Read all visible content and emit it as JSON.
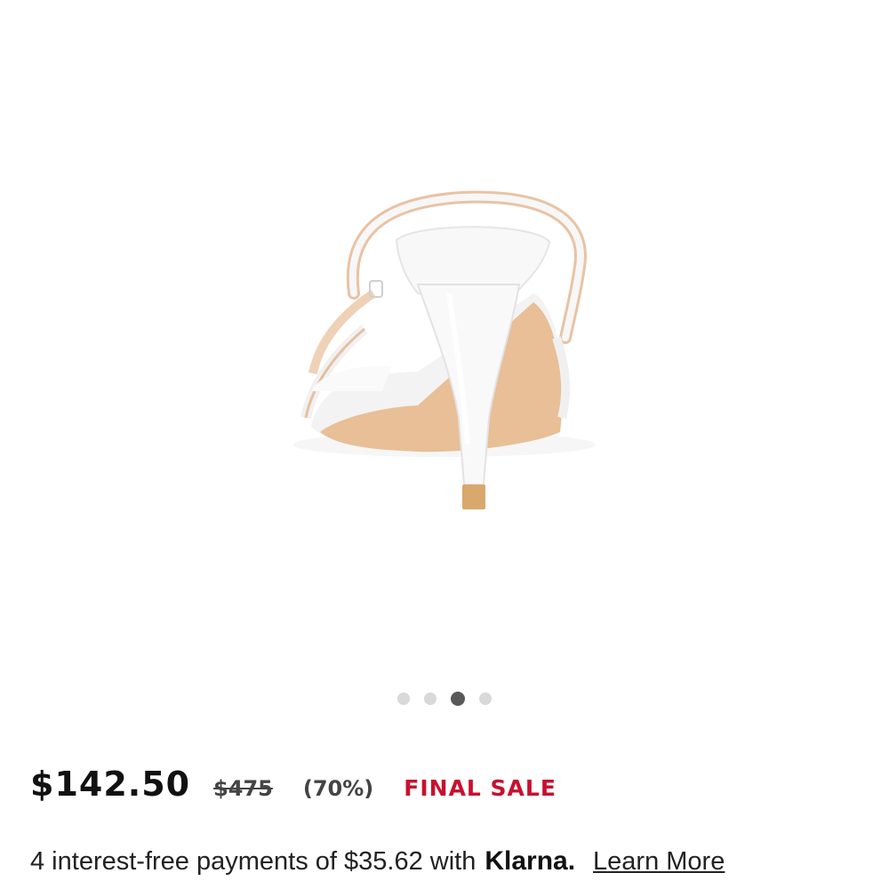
{
  "product_image": {
    "alt_icon": "white-strappy-heel-sandal-image"
  },
  "carousel": {
    "count": 4,
    "active_index": 2
  },
  "pricing": {
    "current_price": "$142.50",
    "original_price": "$475",
    "discount": "(70%)",
    "sale_label": "FINAL SALE",
    "sale_color": "#c8102e"
  },
  "payments": {
    "text": "4 interest-free payments of $35.62 with",
    "provider": "Klarna.",
    "link_label": "Learn More"
  }
}
